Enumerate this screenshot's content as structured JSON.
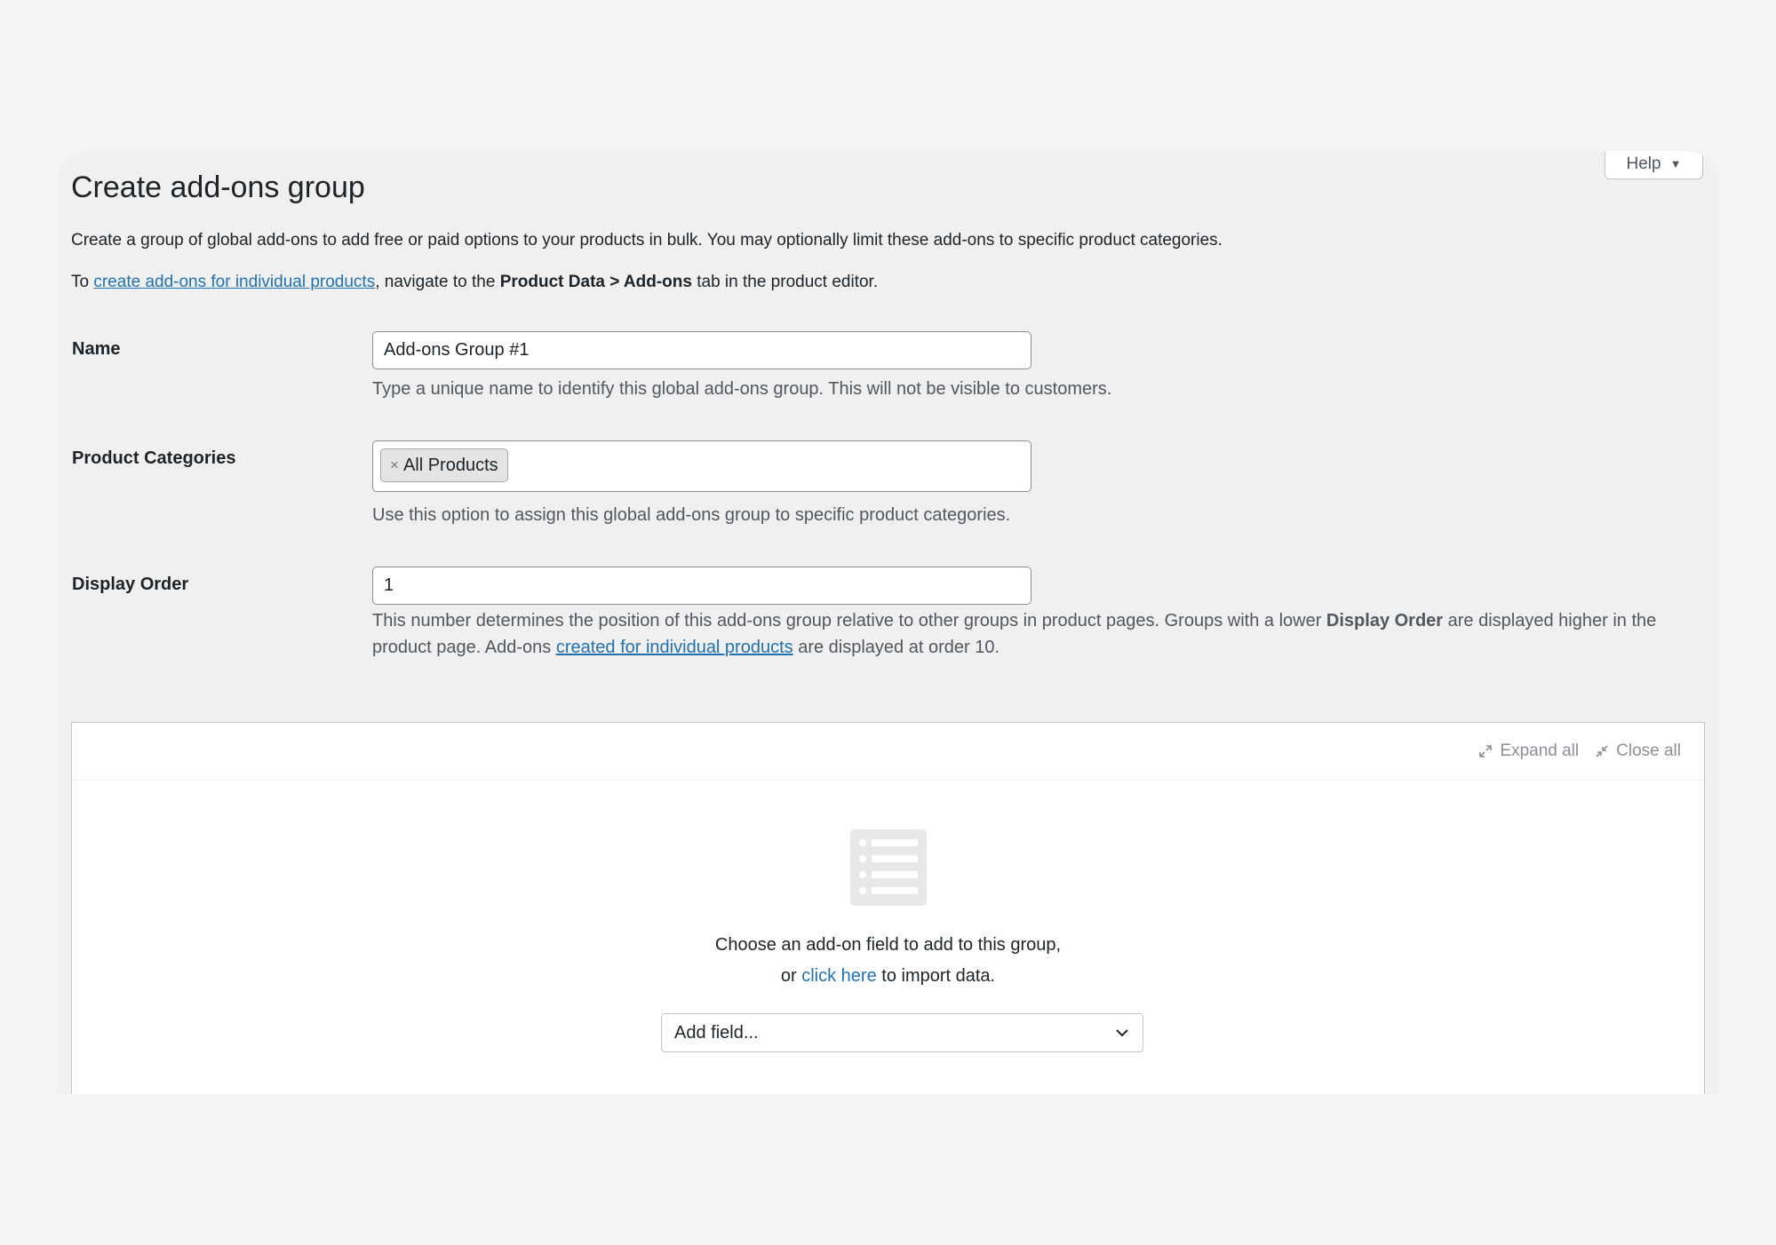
{
  "help": {
    "label": "Help",
    "caret": "▼"
  },
  "page": {
    "title": "Create add-ons group",
    "description": "Create a group of global add-ons to add free or paid options to your products in bulk. You may optionally limit these add-ons to specific product categories.",
    "note_prefix": "To ",
    "note_link": "create add-ons for individual products",
    "note_mid": ", navigate to the ",
    "note_bold": "Product Data > Add-ons",
    "note_suffix": " tab in the product editor."
  },
  "fields": {
    "name": {
      "label": "Name",
      "value": "Add-ons Group #1",
      "help": "Type a unique name to identify this global add-ons group. This will not be visible to customers."
    },
    "categories": {
      "label": "Product Categories",
      "tags": [
        "All Products"
      ],
      "tag_remove": "×",
      "help": "Use this option to assign this global add-ons group to specific product categories."
    },
    "display_order": {
      "label": "Display Order",
      "value": "1",
      "help_part1": "This number determines the position of this add-ons group relative to other groups in product pages. Groups with a lower ",
      "help_bold": "Display Order",
      "help_part2": " are displayed higher in the product page. Add-ons ",
      "help_link": "created for individual products",
      "help_part3": " are displayed at order 10."
    }
  },
  "builder": {
    "expand_all": "Expand all",
    "close_all": "Close all",
    "empty_icon": "list-icon",
    "empty_line1": "Choose an add-on field to add to this group,",
    "empty_line2_prefix": "or ",
    "empty_line2_link": "click here",
    "empty_line2_suffix": " to import data.",
    "add_field_placeholder": "Add field..."
  },
  "colors": {
    "page_bg": "#f3f4f6",
    "panel_bg": "#f0f0f1",
    "link": "#2271b1",
    "muted_text": "#50575e"
  }
}
